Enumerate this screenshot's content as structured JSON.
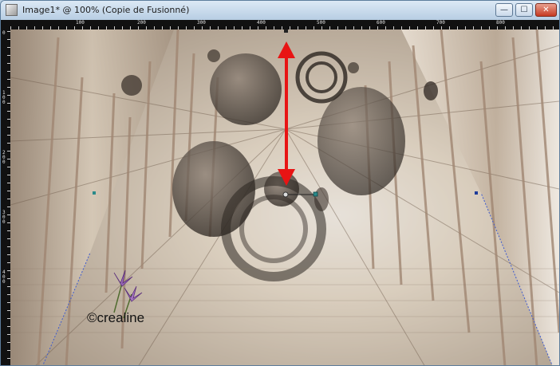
{
  "window": {
    "title": "Image1* @ 100% (Copie de Fusionné)",
    "controls": {
      "minimize": "—",
      "maximize": "☐",
      "close": "✕"
    }
  },
  "ruler": {
    "top_labels": [
      "100",
      "200",
      "300",
      "400",
      "500",
      "600",
      "700",
      "800"
    ],
    "left_labels": [
      "0",
      "100",
      "200",
      "300",
      "400"
    ]
  },
  "canvas": {
    "watermark": "©crealine",
    "arrow_color": "#e81414",
    "icons": [
      "flower-icon",
      "double-arrow-icon",
      "transform-handle-icon"
    ]
  }
}
